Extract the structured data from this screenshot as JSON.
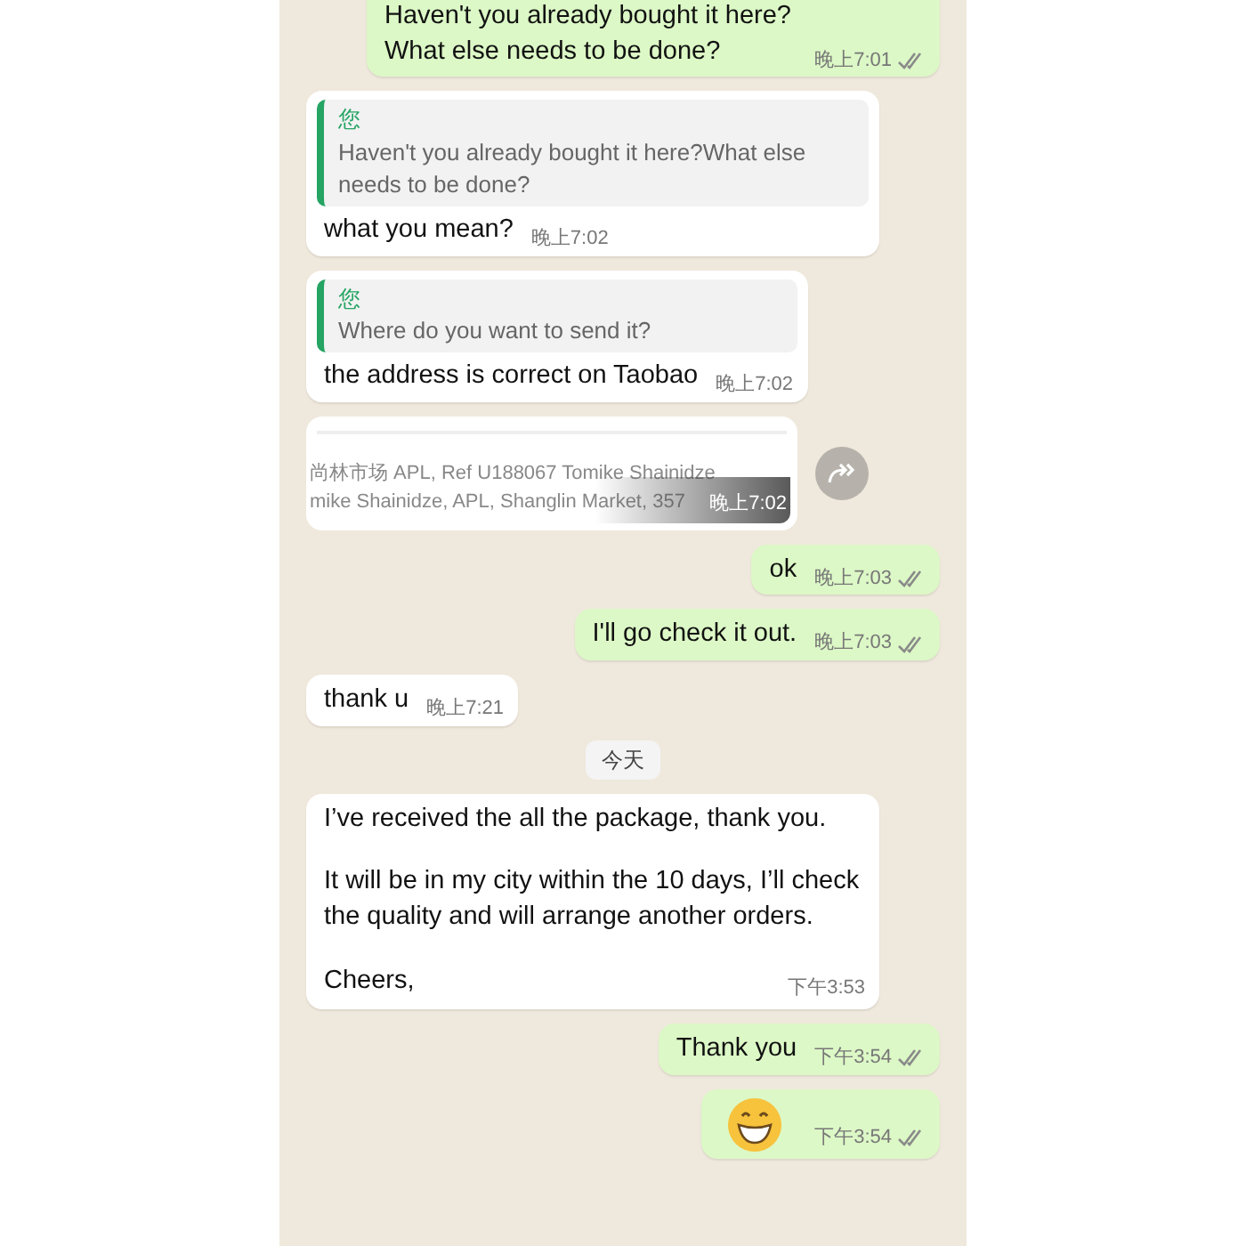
{
  "messages": [
    {
      "kind": "out",
      "text": "Haven't you already bought it here?What else needs to be done?",
      "time": "晚上7:01",
      "read": false
    },
    {
      "kind": "in",
      "quote": {
        "author": "您",
        "text": "Haven't you already bought it here?What else needs to be done?"
      },
      "text": "what you mean?",
      "time": "晚上7:02"
    },
    {
      "kind": "in",
      "quote": {
        "author": "您",
        "text": "Where do you want to send it?"
      },
      "text": "the address is correct on Taobao",
      "time": "晚上7:02"
    },
    {
      "kind": "image",
      "lines": [
        "尚林市场 APL, Ref U188067 Tomike Shainidze",
        "mike Shainidze, APL, Shanglin Market, 357"
      ],
      "time": "晚上7:02"
    },
    {
      "kind": "out",
      "text": "ok",
      "time": "晚上7:03",
      "read": false
    },
    {
      "kind": "out",
      "text": "I'll go check it out.",
      "time": "晚上7:03",
      "read": false
    },
    {
      "kind": "in",
      "text": "thank u",
      "time": "晚上7:21"
    },
    {
      "kind": "date",
      "text": "今天"
    },
    {
      "kind": "in",
      "paragraphs": [
        "I’ve received the all the package, thank you.",
        "It will be in my city within the 10 days, I’ll check the quality and will arrange another orders.",
        "Cheers,"
      ],
      "time": "下午3:53"
    },
    {
      "kind": "out",
      "text": "Thank you",
      "time": "下午3:54",
      "read": false
    },
    {
      "kind": "emoji",
      "time": "下午3:54",
      "read": false
    }
  ]
}
